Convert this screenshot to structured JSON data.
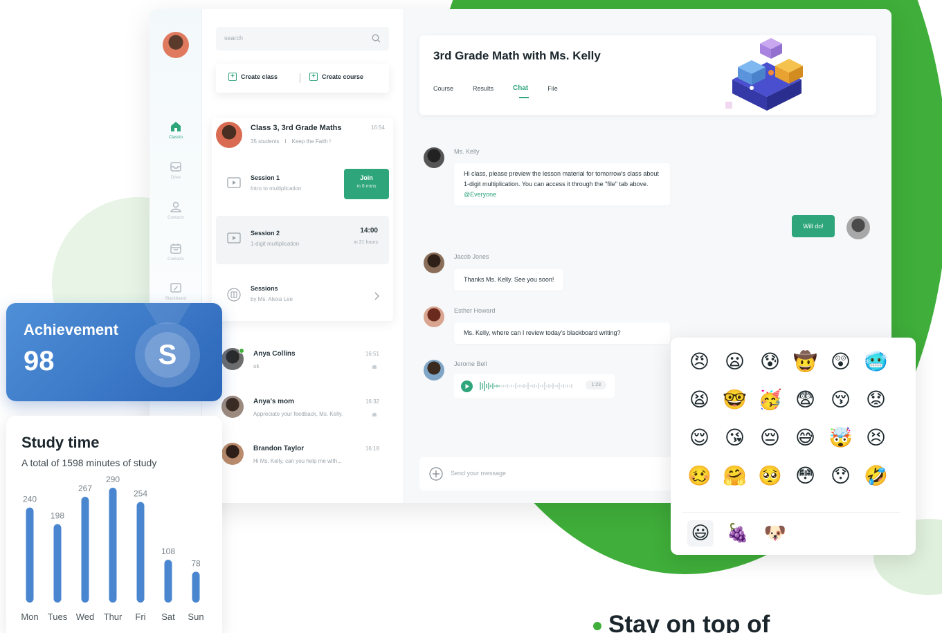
{
  "sidebar": {
    "items": [
      {
        "label": "ClassIn",
        "icon": "home-icon"
      },
      {
        "label": "Drive",
        "icon": "inbox-icon"
      },
      {
        "label": "Contacts",
        "icon": "user-icon"
      },
      {
        "label": "Contacts",
        "icon": "calendar-icon"
      },
      {
        "label": "Blackboard",
        "icon": "blackboard-icon"
      }
    ]
  },
  "list": {
    "search_placeholder": "search",
    "create_class": "Create class",
    "create_course": "Create course",
    "class_card": {
      "title": "Class 3, 3rd Grade Maths",
      "time": "16:54",
      "students": "35 students",
      "separator": "I",
      "motto": "Keep the Faith !",
      "sessions": [
        {
          "title": "Session 1",
          "subtitle": "Intro to multiplication",
          "join_label": "Join",
          "join_sub": "in 6 mins"
        },
        {
          "title": "Session 2",
          "subtitle": "1-digit multiplication",
          "time": "14:00",
          "time_sub": "in 21 hours"
        },
        {
          "title": "Sessions",
          "subtitle": "by Ms. Alexa Lee"
        }
      ]
    },
    "contacts": [
      {
        "name": "Anya Collins",
        "message": "ok",
        "time": "16:51"
      },
      {
        "name": "Anya's mom",
        "message": "Appreciate your feedback, Ms. Kelly.",
        "time": "16:32"
      },
      {
        "name": "Brandon Taylor",
        "message": "Hi Ms. Kelly, can you help me with...",
        "time": "16:18"
      }
    ]
  },
  "chat": {
    "title": "3rd Grade Math with Ms. Kelly",
    "tabs": [
      "Course",
      "Results",
      "Chat",
      "File"
    ],
    "active_tab": "Chat",
    "messages": [
      {
        "name": "Ms. Kelly",
        "text": "Hi class, please preview the lesson material for tomorrow's class about 1-digit multiplication. You can access it through the \"file\" tab above.",
        "mention": "@Everyone"
      },
      {
        "name": "Jacob Jones",
        "text": "Thanks Ms. Kelly. See you soon!"
      },
      {
        "name": "Esther Howard",
        "text": "Ms. Kelly, where can I review today's blackboard writing?"
      },
      {
        "name": "Jerome Bell",
        "voice_duration": "1:23"
      }
    ],
    "my_reply": "Will do!",
    "composer_placeholder": "Send your message"
  },
  "emoji_panel": {
    "emojis": [
      "😠",
      "😦",
      "😰",
      "🤠",
      "😲",
      "🥶",
      "😫",
      "🤓",
      "🥳",
      "😨",
      "😚",
      "😟",
      "😌",
      "😘",
      "😔",
      "😅",
      "🤯",
      "😣",
      "🥴",
      "🤗",
      "🥺",
      "😳",
      "😯",
      "🤣"
    ],
    "tabs": [
      "😃",
      "🍇",
      "🐶"
    ]
  },
  "achievement": {
    "title": "Achievement",
    "score": "98",
    "badge": "S"
  },
  "study": {
    "title": "Study time",
    "subtitle": "A total of 1598 minutes of study"
  },
  "chart_data": {
    "type": "bar",
    "categories": [
      "Mon",
      "Tues",
      "Wed",
      "Thur",
      "Fri",
      "Sat",
      "Sun"
    ],
    "values": [
      240,
      198,
      267,
      290,
      254,
      108,
      78
    ],
    "title": "",
    "xlabel": "",
    "ylabel": "",
    "ylim": [
      0,
      290
    ],
    "grid": false
  },
  "tagline": "Stay on top of",
  "colors": {
    "brand_green": "#2ea57a",
    "blob_green": "#3fae3a",
    "bar_blue": "#4a86cf",
    "achievement_blue": "#3a78c8"
  }
}
